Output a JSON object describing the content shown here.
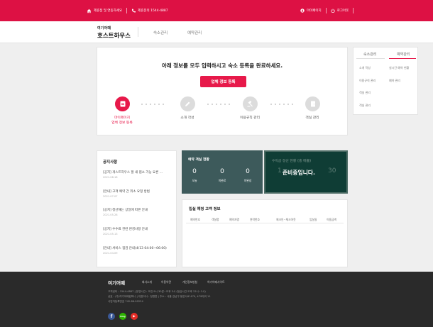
{
  "topbar": {
    "left_text": "제휴점 및 연동하세요",
    "phone_text": "제휴문의 1544-4887",
    "mypage": "마이페이지",
    "logout": "로그아웃"
  },
  "header": {
    "logo_top": "여기어때",
    "logo_bottom": "호스트하우스",
    "nav": [
      "숙소관리",
      "예약관리"
    ]
  },
  "banner": {
    "title": "아래 정보를 모두 입력하시고 숙소 등록을 완료하세요.",
    "button": "업체 정보 등록",
    "steps": [
      {
        "line1": "마이페이지",
        "line2": "업체 정보 등록"
      },
      {
        "line1": "소개 작성",
        "line2": ""
      },
      {
        "line1": "이용규칙 관리",
        "line2": ""
      },
      {
        "line1": "객실 관리",
        "line2": ""
      }
    ]
  },
  "side_tabs": {
    "tab1": "숙소관리",
    "tab2": "예약관리",
    "col1": [
      "소개 작성",
      "이용규칙 관리",
      "객실 관리",
      "객실 관리"
    ],
    "col2": [
      "실시간 예약 현황",
      "예약 관리"
    ]
  },
  "notice": {
    "title": "공지사항",
    "items": [
      {
        "title": "[공지] 게스트하우스 할 새 접소 가능 요론 ...",
        "date": "2021.08.18"
      },
      {
        "title": "[안내] 고객 예약 간 취소 요청 방법",
        "date": "2021.07.07"
      },
      {
        "title": "[공지] 정산해는 상일에 따른 안내",
        "date": "2021.05.28"
      },
      {
        "title": "[공지] 수수료 관련 변경사항 안내",
        "date": "2021.05.13"
      },
      {
        "title": "[안내] 서비스 점검 안내(4/13 04:00~06:00)",
        "date": "2021.04.09"
      }
    ]
  },
  "stats": {
    "title": "예약 객실 현황",
    "items": [
      {
        "value": "0",
        "label": "오늘"
      },
      {
        "value": "0",
        "label": "미완료"
      },
      {
        "value": "0",
        "label": "미완성"
      }
    ]
  },
  "settle": {
    "title": "수익금 정산 현황 (총 매출)",
    "values": [
      "1",
      "30"
    ],
    "message": "준비중입니다."
  },
  "upcoming": {
    "title": "입실 예정 고객 정보",
    "columns": [
      "예약번호",
      "객실명",
      "예약자명",
      "연락번호",
      "체크인~체크아웃",
      "입실일",
      "이용금액"
    ]
  },
  "footer": {
    "logo": "여기어때",
    "links": [
      "회사소개",
      "이용약관",
      "개인정보방침",
      "여기어때사이트"
    ],
    "info": [
      "고객센터 : 1544-4887  |  운영시간 : 오전 9시 30분~오후 3시 (점심시간 오후 12시~1시)",
      "상호 : (주)여기어때컴퍼니  |  대표이사 : 정명훈  |  주소 : 서울 강남구 봉은사로 479, 479타워 11",
      "사업자등록번호 742-86-00224"
    ],
    "sns": [
      {
        "name": "facebook-icon",
        "glyph": "f",
        "color": "#3b5998"
      },
      {
        "name": "naver-blog-icon",
        "glyph": "blog",
        "color": "#2db400"
      },
      {
        "name": "youtube-icon",
        "glyph": "▶",
        "color": "#e52d27"
      }
    ]
  },
  "colors": {
    "brand": "#dd1144",
    "accent": "#e7194a",
    "teal": "#3d5a5b",
    "green": "#0f3d35"
  }
}
